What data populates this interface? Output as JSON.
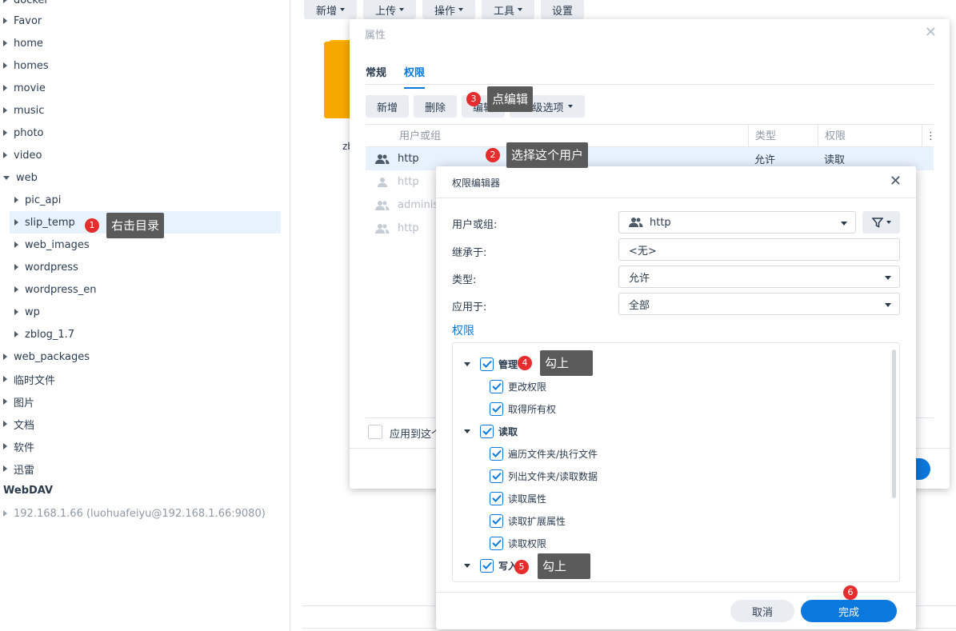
{
  "sidebar": {
    "items": [
      {
        "label": "docker"
      },
      {
        "label": "Favor"
      },
      {
        "label": "home"
      },
      {
        "label": "homes"
      },
      {
        "label": "movie"
      },
      {
        "label": "music"
      },
      {
        "label": "photo"
      },
      {
        "label": "video"
      },
      {
        "label": "web"
      },
      {
        "label": "pic_api"
      },
      {
        "label": "slip_temp"
      },
      {
        "label": "web_images"
      },
      {
        "label": "wordpress"
      },
      {
        "label": "wordpress_en"
      },
      {
        "label": "wp"
      },
      {
        "label": "zblog_1.7"
      },
      {
        "label": "web_packages"
      },
      {
        "label": "临时文件"
      },
      {
        "label": "图片"
      },
      {
        "label": "文档"
      },
      {
        "label": "软件"
      },
      {
        "label": "迅雷"
      }
    ],
    "webdav_title": "WebDAV",
    "webdav_item": "192.168.1.66 (luohuafeiyu@192.168.1.66:9080)"
  },
  "toolbar": {
    "new": "新增",
    "upload": "上传",
    "action": "操作",
    "tools": "工具",
    "settings": "设置"
  },
  "folder": {
    "label": "zb"
  },
  "props": {
    "title": "属性",
    "tabs": [
      "常规",
      "权限"
    ],
    "buttons": {
      "add": "新增",
      "delete": "删除",
      "edit": "编辑",
      "advanced": "高级选项"
    },
    "columns": {
      "user": "用户或组",
      "type": "类型",
      "perm": "权限"
    },
    "rows": [
      {
        "user": "http",
        "type": "允许",
        "perm": "读取"
      },
      {
        "user": "http",
        "type": "",
        "perm": ""
      },
      {
        "user": "adminis",
        "type": "",
        "perm": ""
      },
      {
        "user": "http",
        "type": "",
        "perm": ""
      }
    ],
    "apply_label": "应用到这个"
  },
  "editor": {
    "title": "权限编辑器",
    "fields": {
      "user_label": "用户或组:",
      "user_value": "http",
      "inherit_label": "继承于:",
      "inherit_value": "<无>",
      "type_label": "类型:",
      "type_value": "允许",
      "apply_label": "应用于:",
      "apply_value": "全部"
    },
    "section": "权限",
    "groups": {
      "manage": "管理",
      "manage_items": [
        "更改权限",
        "取得所有权"
      ],
      "read": "读取",
      "read_items": [
        "遍历文件夹/执行文件",
        "列出文件夹/读取数据",
        "读取属性",
        "读取扩展属性",
        "读取权限"
      ],
      "write": "写入"
    },
    "cancel": "取消",
    "done": "完成"
  },
  "annotations": [
    {
      "num": "1",
      "text": "右击目录"
    },
    {
      "num": "2",
      "text": "选择这个用户"
    },
    {
      "num": "3",
      "text": "点编辑"
    },
    {
      "num": "4",
      "text": "勾上"
    },
    {
      "num": "5",
      "text": "勾上"
    },
    {
      "num": "6",
      "text": ""
    }
  ],
  "colors": {
    "accent": "#0a78dc",
    "badge": "#e52d2d",
    "folder": "#f7a800"
  }
}
